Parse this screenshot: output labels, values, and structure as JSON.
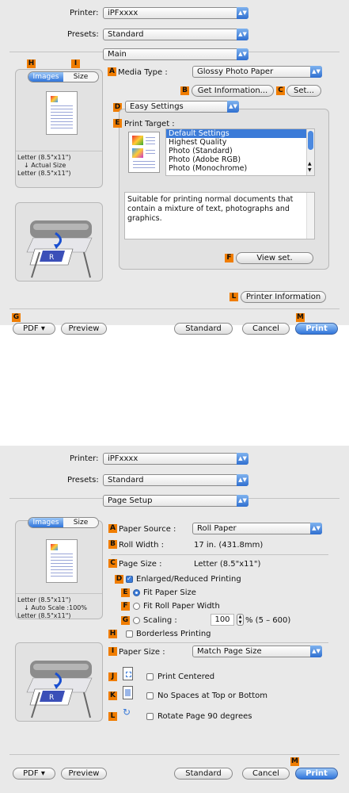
{
  "colors": {
    "dialog_bg": "#e9e9e9",
    "badge": "#f07d00",
    "accent": "#3b7bd8"
  },
  "top": {
    "printer_label": "Printer:",
    "printer_value": "iPFxxxx",
    "presets_label": "Presets:",
    "presets_value": "Standard",
    "pane_value": "Main",
    "badge_h": "H",
    "badge_i": "I",
    "tabs": [
      "Images",
      "Size"
    ],
    "preview_info": [
      "Letter (8.5\"x11\")",
      "↓ Actual Size",
      "Letter (8.5\"x11\")"
    ],
    "badge_a": "A",
    "media_label": "Media Type :",
    "media_value": "Glossy Photo Paper",
    "badge_b": "B",
    "get_info": "Get Information...",
    "badge_c": "C",
    "set": "Set...",
    "badge_d": "D",
    "mode_value": "Easy Settings",
    "badge_e": "E",
    "print_target_label": "Print Target :",
    "targets": [
      "Default Settings",
      "Highest Quality",
      "Photo (Standard)",
      "Photo (Adobe RGB)",
      "Photo (Monochrome)"
    ],
    "description": "Suitable for printing normal documents that contain a mixture of text, photographs and graphics.",
    "badge_f": "F",
    "view_set": "View set.",
    "badge_l": "L",
    "printer_info": "Printer Information",
    "badge_g": "G",
    "pdf": "PDF ▾",
    "preview": "Preview",
    "standard": "Standard",
    "cancel": "Cancel",
    "badge_m": "M",
    "print": "Print"
  },
  "bottom": {
    "printer_label": "Printer:",
    "printer_value": "iPFxxxx",
    "presets_label": "Presets:",
    "presets_value": "Standard",
    "pane_value": "Page Setup",
    "tabs": [
      "Images",
      "Size"
    ],
    "preview_info": [
      "Letter (8.5\"x11\")",
      "↓ Auto Scale :100%",
      "Letter (8.5\"x11\")"
    ],
    "badge_a": "A",
    "paper_source_label": "Paper Source :",
    "paper_source_value": "Roll Paper",
    "badge_b": "B",
    "roll_width_label": "Roll Width :",
    "roll_width_value": "17 in. (431.8mm)",
    "badge_c": "C",
    "page_size_label": "Page Size :",
    "page_size_value": "Letter (8.5\"x11\")",
    "badge_d": "D",
    "enlarged": "Enlarged/Reduced Printing",
    "badge_e": "E",
    "fit_paper": "Fit Paper Size",
    "badge_f": "F",
    "fit_roll": "Fit Roll Paper Width",
    "badge_g": "G",
    "scaling": "Scaling :",
    "scaling_value": "100",
    "scaling_range": "% (5 – 600)",
    "badge_h": "H",
    "borderless": "Borderless Printing",
    "badge_i": "I",
    "paper_size_label": "Paper Size :",
    "paper_size_value": "Match Page Size",
    "badge_j": "J",
    "print_centered": "Print Centered",
    "badge_k": "K",
    "no_spaces": "No Spaces at Top or Bottom",
    "badge_l": "L",
    "rotate": "Rotate Page 90 degrees",
    "pdf": "PDF ▾",
    "preview": "Preview",
    "standard": "Standard",
    "cancel": "Cancel",
    "badge_m": "M",
    "print": "Print"
  }
}
